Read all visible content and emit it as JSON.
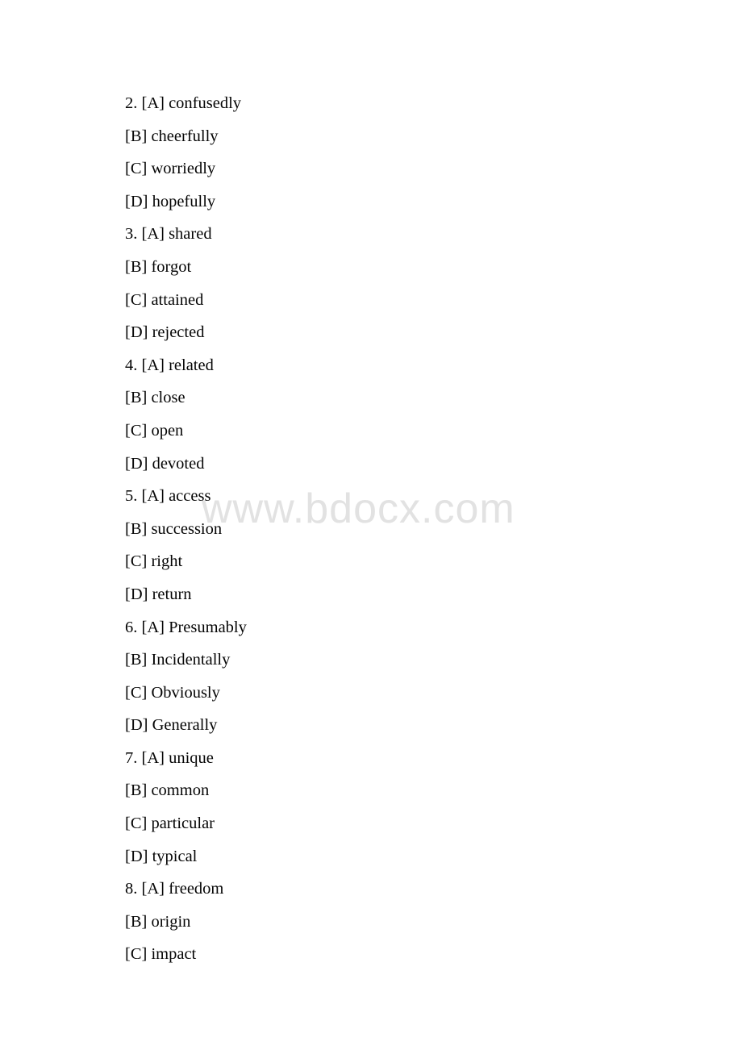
{
  "document": {
    "background_color": "#ffffff",
    "text_color": "#000000",
    "watermark": {
      "text": "www.bdocx.com",
      "color": "#e2e2e2"
    },
    "lines": [
      {
        "text": "2. [A] confusedly"
      },
      {
        "text": "[B] cheerfully"
      },
      {
        "text": "[C] worriedly"
      },
      {
        "text": "[D] hopefully"
      },
      {
        "text": "3. [A] shared"
      },
      {
        "text": "[B] forgot"
      },
      {
        "text": "[C] attained"
      },
      {
        "text": "[D] rejected"
      },
      {
        "text": "4. [A] related"
      },
      {
        "text": "[B] close"
      },
      {
        "text": "[C] open"
      },
      {
        "text": "[D] devoted"
      },
      {
        "text": "5. [A] access"
      },
      {
        "text": "[B] succession"
      },
      {
        "text": "[C] right"
      },
      {
        "text": "[D] return"
      },
      {
        "text": "6. [A] Presumably"
      },
      {
        "text": "[B] Incidentally"
      },
      {
        "text": "[C] Obviously"
      },
      {
        "text": "[D] Generally"
      },
      {
        "text": "7. [A] unique"
      },
      {
        "text": "[B] common"
      },
      {
        "text": "[C] particular"
      },
      {
        "text": "[D] typical"
      },
      {
        "text": "8. [A] freedom"
      },
      {
        "text": "[B] origin"
      },
      {
        "text": "[C] impact"
      }
    ]
  }
}
